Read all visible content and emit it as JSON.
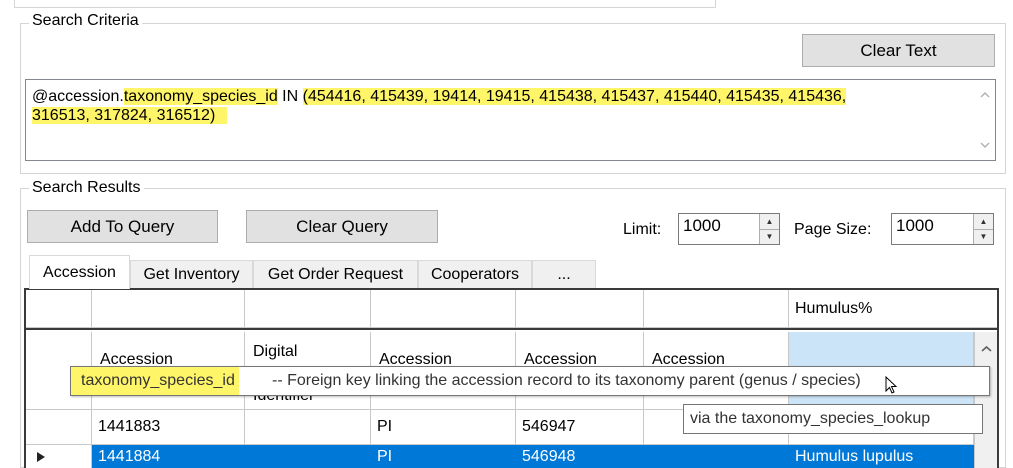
{
  "search_criteria": {
    "legend": "Search Criteria",
    "clear_text_label": "Clear Text",
    "query_prefix": "@accession.",
    "query_field": "taxonomy_species_id",
    "query_op": " IN ",
    "query_values_line1": "(454416, 415439, 19414, 19415, 415438, 415437, 415440, 415435, 415436,",
    "query_values_line2": "316513, 317824, 316512)"
  },
  "search_results": {
    "legend": "Search Results",
    "add_to_query_label": "Add To Query",
    "clear_query_label": "Clear Query",
    "limit_label": "Limit:",
    "limit_value": "1000",
    "page_size_label": "Page Size:",
    "page_size_value": "1000"
  },
  "tabs": [
    {
      "label": "Accession",
      "active": true
    },
    {
      "label": "Get Inventory"
    },
    {
      "label": "Get Order Request"
    },
    {
      "label": "Cooperators"
    },
    {
      "label": "..."
    }
  ],
  "grid": {
    "filter_row": [
      "",
      "",
      "",
      "",
      "",
      "",
      "Humulus%"
    ],
    "headers": [
      "",
      "Accession",
      "Digital",
      "Accession",
      "Accession",
      "Accession",
      ""
    ],
    "header_second_line": [
      "",
      "",
      "Identifier",
      "",
      "",
      "",
      ""
    ],
    "rows": [
      [
        "",
        "1441883",
        "",
        "PI",
        "546947",
        "",
        ""
      ],
      [
        "",
        "1441884",
        "",
        "PI",
        "546948",
        "",
        "Humulus lupulus"
      ]
    ],
    "selected_row": 1
  },
  "tooltip": {
    "field": "taxonomy_species_id",
    "description": " -- Foreign key linking the accession record to its taxonomy parent (genus / species)",
    "line2": "via the taxonomy_species_lookup"
  },
  "colors": {
    "highlight": "#fff568",
    "selection": "#0078d7",
    "button_bg": "#e1e1e1"
  }
}
